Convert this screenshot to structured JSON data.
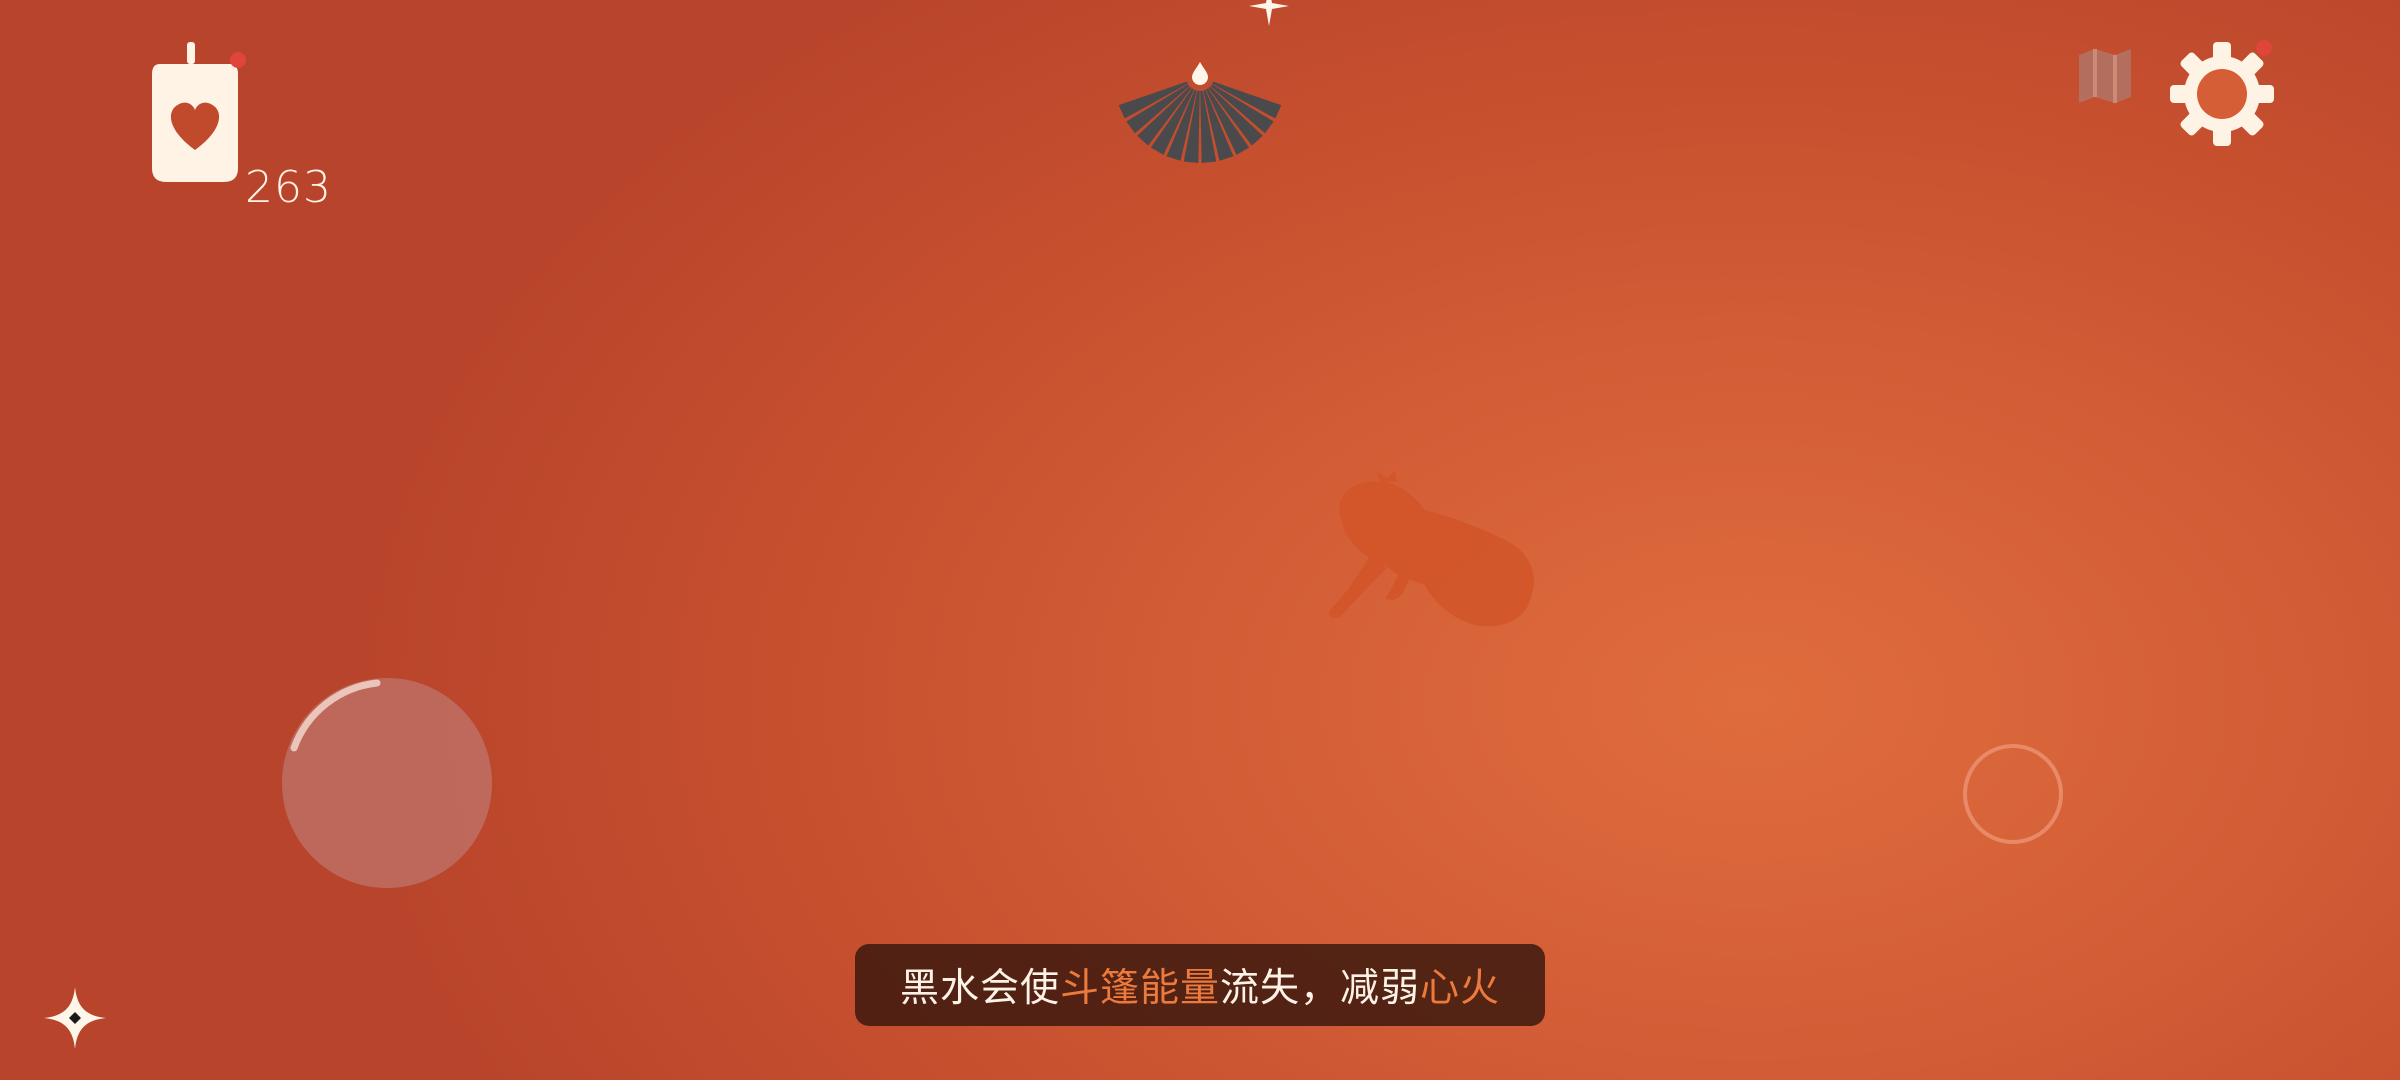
{
  "hud": {
    "candle_count": "263",
    "candle_icon": "heart-candle-icon",
    "cape_energy_icon": "cape-energy-fan-icon",
    "map_icon": "map-icon",
    "settings_icon": "gear-icon",
    "sparkle_icon": "sparkle-star-icon",
    "notification_color": "#e0453a"
  },
  "tip": {
    "part1": "黑水会使",
    "highlight1": "斗篷能量",
    "part2": "流失，减弱",
    "highlight2": "心火"
  },
  "colors": {
    "background": "#d45f37",
    "highlight_text": "#ec7a3c",
    "banner": "#3a180e",
    "cape_wedges": "#4a4a4c"
  }
}
